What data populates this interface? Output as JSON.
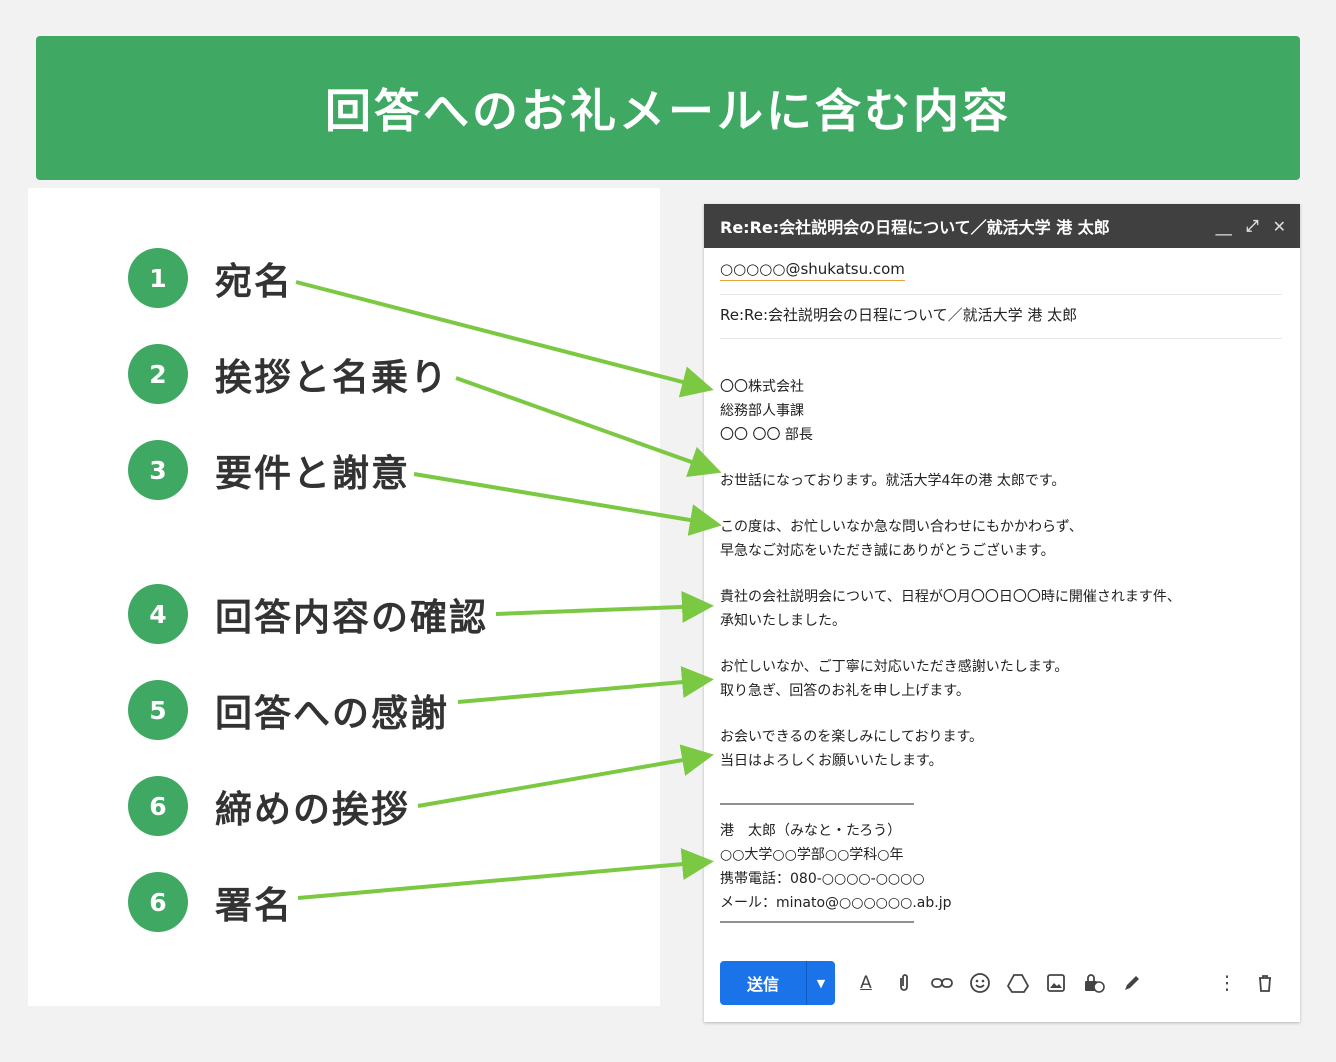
{
  "header": {
    "title": "回答へのお礼メールに含む内容"
  },
  "items": [
    {
      "number": "1",
      "label": "宛名"
    },
    {
      "number": "2",
      "label": "挨拶と名乗り"
    },
    {
      "number": "3",
      "label": "要件と謝意"
    },
    {
      "number": "4",
      "label": "回答内容の確認"
    },
    {
      "number": "5",
      "label": "回答への感謝"
    },
    {
      "number": "6",
      "label": "締めの挨拶"
    },
    {
      "number": "6",
      "label": "署名"
    }
  ],
  "mail": {
    "window_title": "Re:Re:会社説明会の日程について／就活大学 港 太郎",
    "controls": {
      "minimize": "＿",
      "expand": "⤢",
      "close": "✕"
    },
    "to": "○○○○○@shukatsu.com",
    "subject": "Re:Re:会社説明会の日程について／就活大学 港 太郎",
    "body": [
      "〇〇株式会社",
      "総務部人事課",
      "〇〇 〇〇 部長",
      "お世話になっております。就活大学4年の港 太郎です。",
      "この度は、お忙しいなか急な問い合わせにもかかわらず、",
      "早急なご対応をいただき誠にありがとうございます。",
      "貴社の会社説明会について、日程が〇月〇〇日〇〇時に開催されます件、",
      "承知いたしました。",
      "お忙しいなか、ご丁寧に対応いただき感謝いたします。",
      "取り急ぎ、回答のお礼を申し上げます。",
      "お会いできるのを楽しみにしております。",
      "当日はよろしくお願いいたします。",
      "――――――――――――――――",
      "港　太郎（みなと・たろう）",
      "○○大学○○学部○○学科○年",
      "携帯電話：080-○○○○-○○○○",
      "メール：minato@○○○○○○.ab.jp",
      "――――――――――――――――"
    ],
    "send_label": "送信",
    "toolbar_icons": [
      "format-text-icon",
      "attach-icon",
      "link-icon",
      "emoji-icon",
      "drive-icon",
      "image-icon",
      "confidential-icon",
      "signature-icon"
    ],
    "more_icons": [
      "more-options-icon",
      "trash-icon"
    ]
  },
  "colors": {
    "accent": "#3fa964",
    "arrow": "#7bc943",
    "send": "#1a73e8"
  }
}
